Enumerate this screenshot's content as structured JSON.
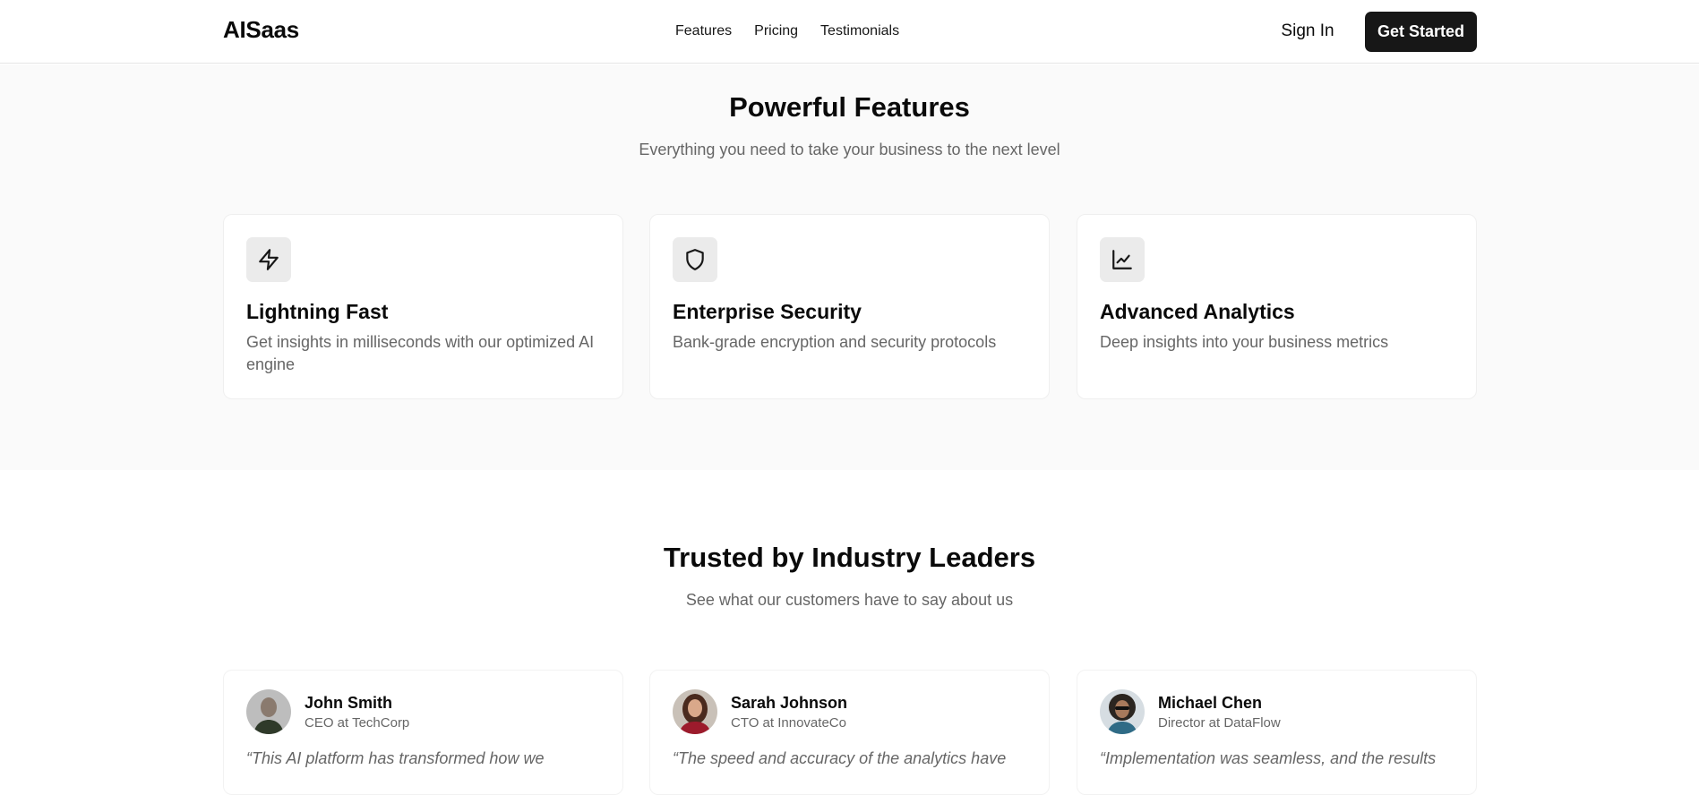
{
  "header": {
    "logo": "AISaas",
    "nav": [
      "Features",
      "Pricing",
      "Testimonials"
    ],
    "sign_in": "Sign In",
    "get_started": "Get Started"
  },
  "features": {
    "title": "Powerful Features",
    "subtitle": "Everything you need to take your business to the next level",
    "cards": [
      {
        "icon": "lightning-icon",
        "title": "Lightning Fast",
        "description": "Get insights in milliseconds with our optimized AI engine"
      },
      {
        "icon": "shield-icon",
        "title": "Enterprise Security",
        "description": "Bank-grade encryption and security protocols"
      },
      {
        "icon": "chart-icon",
        "title": "Advanced Analytics",
        "description": "Deep insights into your business metrics"
      }
    ]
  },
  "testimonials": {
    "title": "Trusted by Industry Leaders",
    "subtitle": "See what our customers have to say about us",
    "items": [
      {
        "name": "John Smith",
        "role": "CEO at TechCorp",
        "quote": "“This AI platform has transformed how we"
      },
      {
        "name": "Sarah Johnson",
        "role": "CTO at InnovateCo",
        "quote": "“The speed and accuracy of the analytics have"
      },
      {
        "name": "Michael Chen",
        "role": "Director at DataFlow",
        "quote": "“Implementation was seamless, and the results"
      }
    ]
  },
  "colors": {
    "primary": "#171717",
    "muted_text": "#666666",
    "section_bg": "#fafafa",
    "icon_bg": "#ebebeb"
  }
}
